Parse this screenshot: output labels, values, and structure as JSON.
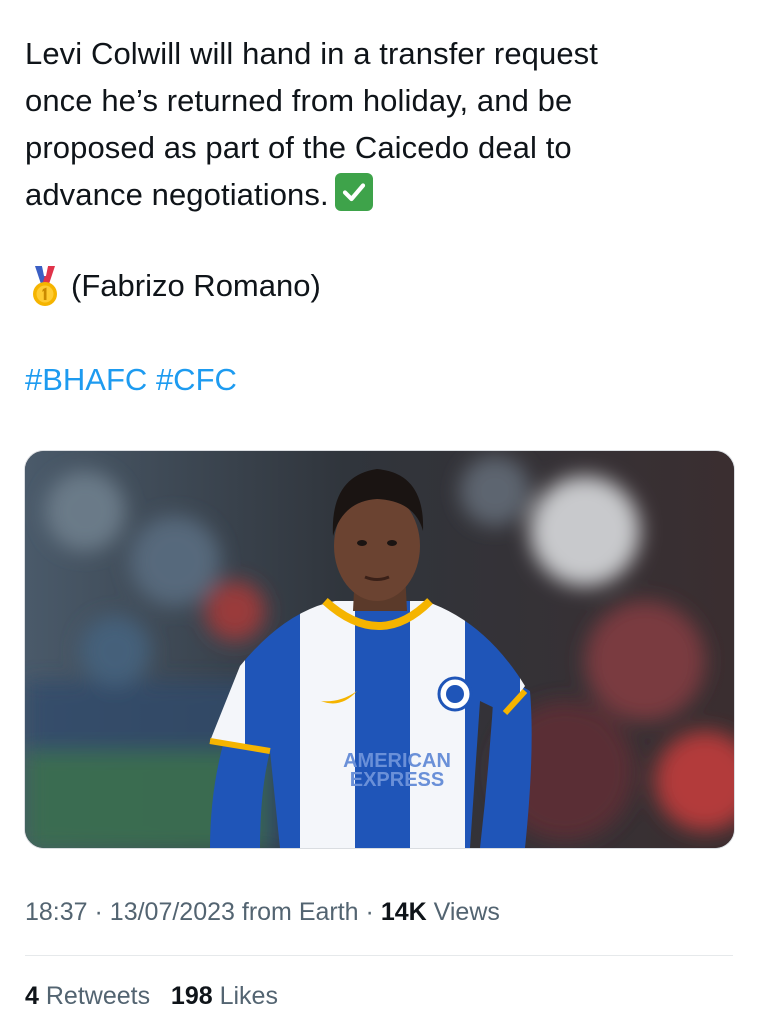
{
  "tweet": {
    "lines": [
      "Levi Colwill will hand in a transfer request",
      "once he’s returned from holiday, and be",
      "proposed as part of the Caicedo deal to",
      "advance negotiations."
    ],
    "source": "(Fabrizo Romano)",
    "hashtags": [
      "#BHAFC",
      "#CFC"
    ]
  },
  "media": {
    "shirt_sponsor_line1": "AMERICAN",
    "shirt_sponsor_line2": "EXPRESS"
  },
  "meta": {
    "time": "18:37",
    "separator": "·",
    "date": "13/07/2023",
    "location": "from Earth",
    "views_count": "14K",
    "views_label": "Views"
  },
  "stats": {
    "retweets_count": "4",
    "retweets_label": "Retweets",
    "likes_count": "198",
    "likes_label": "Likes"
  },
  "icons": {
    "check": "check-mark-button-emoji",
    "medal": "first-place-medal-emoji"
  }
}
